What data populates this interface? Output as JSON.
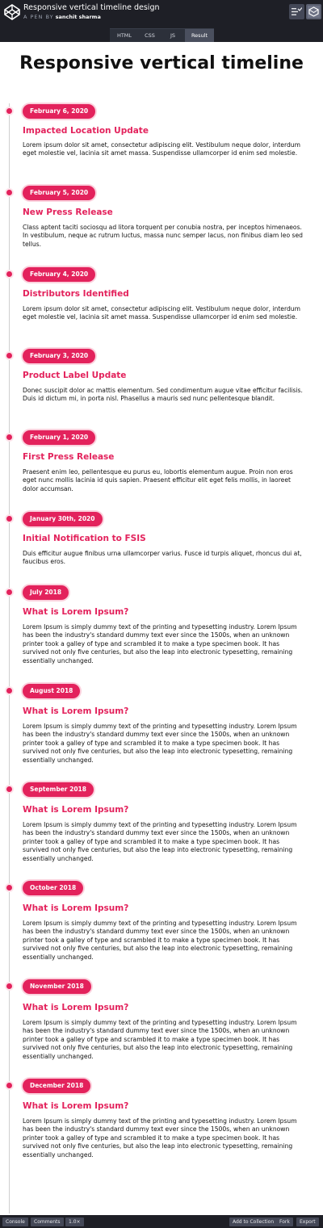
{
  "header": {
    "pen_title": "Responsive vertical timeline design",
    "by_label": "A PEN BY",
    "author": "sanchit sharma"
  },
  "tabs": [
    "HTML",
    "CSS",
    "JS",
    "Result"
  ],
  "active_tab": "Result",
  "page_title": "Responsive vertical timeline",
  "timeline": [
    {
      "date": "February 6, 2020",
      "title": "Impacted Location Update",
      "text": "Lorem ipsum dolor sit amet, consectetur adipiscing elit. Vestibulum neque dolor, interdum eget molestie vel, lacinia sit amet massa. Suspendisse ullamcorper id enim sed molestie."
    },
    {
      "date": "February 5, 2020",
      "title": "New Press Release",
      "text": "Class aptent taciti sociosqu ad litora torquent per conubia nostra, per inceptos himenaeos. In vestibulum, neque ac rutrum luctus, massa nunc semper lacus, non finibus diam leo sed tellus."
    },
    {
      "date": "February 4, 2020",
      "title": "Distributors Identified",
      "text": "Lorem ipsum dolor sit amet, consectetur adipiscing elit. Vestibulum neque dolor, interdum eget molestie vel, lacinia sit amet massa. Suspendisse ullamcorper id enim sed molestie."
    },
    {
      "date": "February 3, 2020",
      "title": "Product Label Update",
      "text": "Donec suscipit dolor ac mattis elementum. Sed condimentum augue vitae efficitur facilisis. Duis id dictum mi, in porta nisl. Phasellus a mauris sed nunc pellentesque blandit."
    },
    {
      "date": "February 1, 2020",
      "title": "First Press Release",
      "text": "Praesent enim leo, pellentesque eu purus eu, lobortis elementum augue. Proin non eros eget nunc mollis lacinia id quis sapien. Praesent efficitur elit eget felis mollis, in laoreet dolor accumsan."
    },
    {
      "date": "January 30th, 2020",
      "title": "Initial Notification to FSIS",
      "text": "Duis efficitur augue finibus urna ullamcorper varius. Fusce id turpis aliquet, rhoncus dui at, faucibus eros."
    },
    {
      "date": "July 2018",
      "title": "What is Lorem Ipsum?",
      "text": "Lorem Ipsum is simply dummy text of the printing and typesetting industry. Lorem Ipsum has been the industry's standard dummy text ever since the 1500s, when an unknown printer took a galley of type and scrambled it to make a type specimen book. It has survived not only five centuries, but also the leap into electronic typesetting, remaining essentially unchanged."
    },
    {
      "date": "August 2018",
      "title": "What is Lorem Ipsum?",
      "text": "Lorem Ipsum is simply dummy text of the printing and typesetting industry. Lorem Ipsum has been the industry's standard dummy text ever since the 1500s, when an unknown printer took a galley of type and scrambled it to make a type specimen book. It has survived not only five centuries, but also the leap into electronic typesetting, remaining essentially unchanged."
    },
    {
      "date": "September 2018",
      "title": "What is Lorem Ipsum?",
      "text": "Lorem Ipsum is simply dummy text of the printing and typesetting industry. Lorem Ipsum has been the industry's standard dummy text ever since the 1500s, when an unknown printer took a galley of type and scrambled it to make a type specimen book. It has survived not only five centuries, but also the leap into electronic typesetting, remaining essentially unchanged."
    },
    {
      "date": "October 2018",
      "title": "What is Lorem Ipsum?",
      "text": "Lorem Ipsum is simply dummy text of the printing and typesetting industry. Lorem Ipsum has been the industry's standard dummy text ever since the 1500s, when an unknown printer took a galley of type and scrambled it to make a type specimen book. It has survived not only five centuries, but also the leap into electronic typesetting, remaining essentially unchanged."
    },
    {
      "date": "November 2018",
      "title": "What is Lorem Ipsum?",
      "text": "Lorem Ipsum is simply dummy text of the printing and typesetting industry. Lorem Ipsum has been the industry's standard dummy text ever since the 1500s, when an unknown printer took a galley of type and scrambled it to make a type specimen book. It has survived not only five centuries, but also the leap into electronic typesetting, remaining essentially unchanged."
    },
    {
      "date": "December 2018",
      "title": "What is Lorem Ipsum?",
      "text": "Lorem Ipsum is simply dummy text of the printing and typesetting industry. Lorem Ipsum has been the industry's standard dummy text ever since the 1500s, when an unknown printer took a galley of type and scrambled it to make a type specimen book. It has survived not only five centuries, but also the leap into electronic typesetting, remaining essentially unchanged."
    }
  ],
  "bottom_bar": {
    "console": "Console",
    "comments": "Comments",
    "zoom": "1.0×",
    "add_to_collection": "Add to Collection",
    "fork": "Fork",
    "export": "Export"
  },
  "colors": {
    "accent": "#e3225c",
    "chrome": "#1e1f26"
  }
}
